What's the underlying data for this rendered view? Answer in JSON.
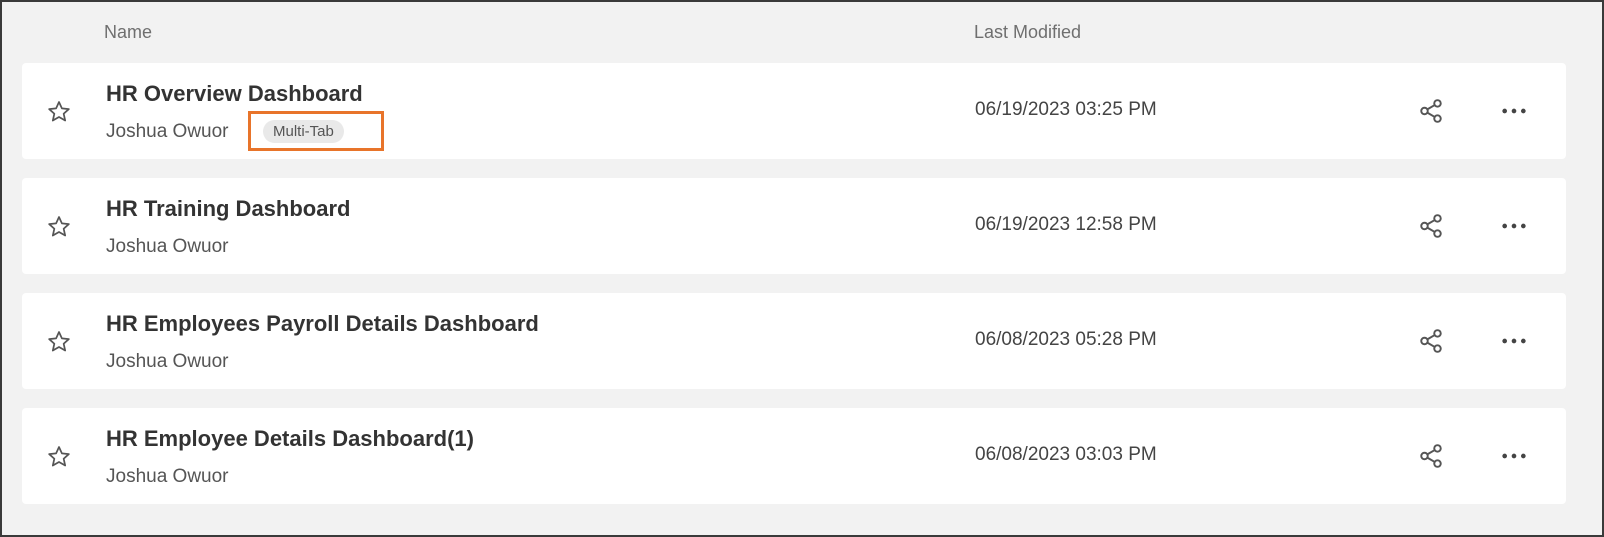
{
  "header": {
    "name_label": "Name",
    "modified_label": "Last Modified"
  },
  "rows": [
    {
      "title": "HR Overview Dashboard",
      "owner": "Joshua Owuor",
      "badge": "Multi-Tab",
      "modified": "06/19/2023 03:25 PM"
    },
    {
      "title": "HR Training Dashboard",
      "owner": "Joshua Owuor",
      "modified": "06/19/2023 12:58 PM"
    },
    {
      "title": "HR Employees Payroll Details Dashboard",
      "owner": "Joshua Owuor",
      "modified": "06/08/2023 05:28 PM"
    },
    {
      "title": "HR Employee Details Dashboard(1)",
      "owner": "Joshua Owuor",
      "modified": "06/08/2023 03:03 PM"
    }
  ],
  "icons": {
    "favorite": "star-icon",
    "share": "share-icon",
    "more": "more-options-icon"
  },
  "colors": {
    "highlight_border": "#e8742a",
    "row_background": "#ffffff",
    "page_background": "#f2f2f2"
  }
}
